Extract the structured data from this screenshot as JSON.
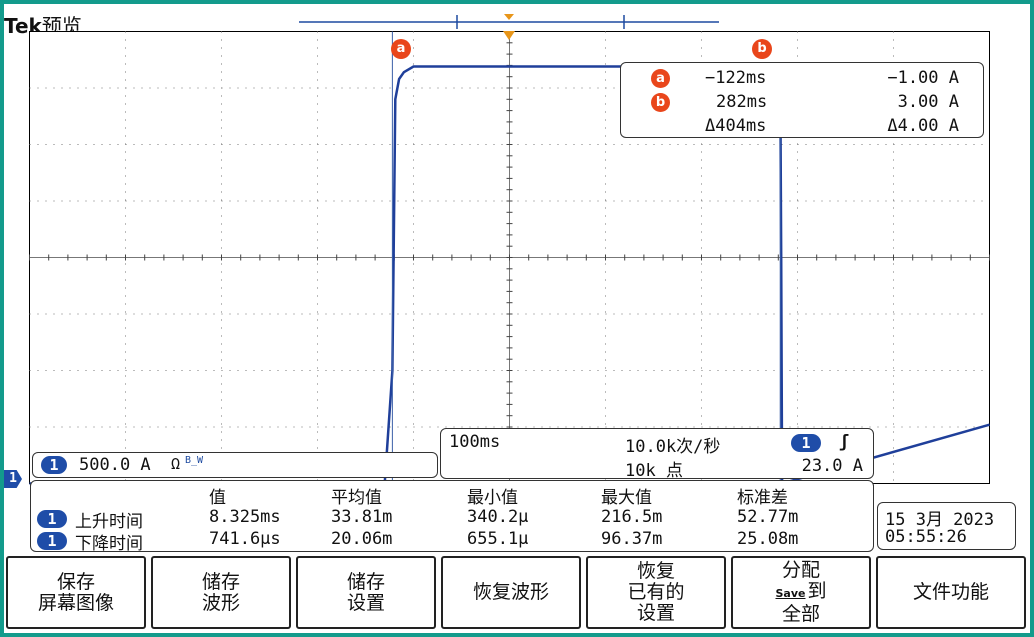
{
  "brand": {
    "tek": "Tek",
    "mode": "预览"
  },
  "cursor_labels": {
    "a": "a",
    "b": "b"
  },
  "cursor_readout": {
    "rows": [
      {
        "id": "a",
        "time": "−122ms",
        "value": "−1.00 A"
      },
      {
        "id": "b",
        "time": "282ms",
        "value": "3.00 A"
      },
      {
        "id": "",
        "time": "Δ404ms",
        "value": "Δ4.00 A"
      }
    ]
  },
  "channel": {
    "number": "1",
    "scale": "500.0 A",
    "suffix": "Ω",
    "bw": "B_W"
  },
  "ground_marker": "1",
  "horizontal": {
    "timebase": "100ms",
    "sample_rate": "10.0k次/秒",
    "record_length": "10k 点",
    "trigger_channel": "1",
    "trigger_slope": "ʃ",
    "trigger_level": "23.0 A"
  },
  "measurements": {
    "headers": [
      "值",
      "平均值",
      "最小值",
      "最大值",
      "标准差"
    ],
    "rows": [
      {
        "ch": "1",
        "name": "上升时间",
        "values": [
          "8.325ms",
          "33.81m",
          "340.2µ",
          "216.5m",
          "52.77m"
        ]
      },
      {
        "ch": "1",
        "name": "下降时间",
        "values": [
          "741.6µs",
          "20.06m",
          "655.1µ",
          "96.37m",
          "25.08m"
        ]
      }
    ]
  },
  "datetime": {
    "date": "15 3月  2023",
    "time": "05:55:26"
  },
  "softkeys": [
    {
      "lines": [
        "保存",
        "屏幕图像"
      ]
    },
    {
      "lines": [
        "储存",
        "波形"
      ]
    },
    {
      "lines": [
        "储存",
        "设置"
      ]
    },
    {
      "lines": [
        "恢复波形"
      ]
    },
    {
      "lines": [
        "恢复",
        "已有的",
        "设置"
      ]
    },
    {
      "lines": [
        "分配",
        "到",
        "全部"
      ],
      "badge": "Save"
    },
    {
      "lines": [
        "文件功能"
      ]
    }
  ],
  "colors": {
    "trace": "#1f3f9a",
    "cursor": "#e9461b",
    "background": "#139b8c",
    "trigger": "#e8961a"
  },
  "chart_data": {
    "type": "line",
    "title": "",
    "xlabel": "",
    "ylabel": "",
    "x_unit": "ms",
    "y_unit": "A",
    "xlim": [
      -500,
      500
    ],
    "ylim": [
      -2000,
      2000
    ],
    "series": [
      {
        "x": [
          -500,
          -130,
          -122,
          -119,
          -115,
          -110,
          -100,
          -90,
          -80,
          282,
          283,
          284,
          500
        ],
        "y": [
          -2000,
          -2000,
          -1000,
          1400,
          1580,
          1640,
          1690,
          1690,
          1690,
          1690,
          0,
          -2000,
          -1480
        ]
      }
    ],
    "cursors": {
      "a_ms": -122,
      "b_ms": 282
    }
  }
}
